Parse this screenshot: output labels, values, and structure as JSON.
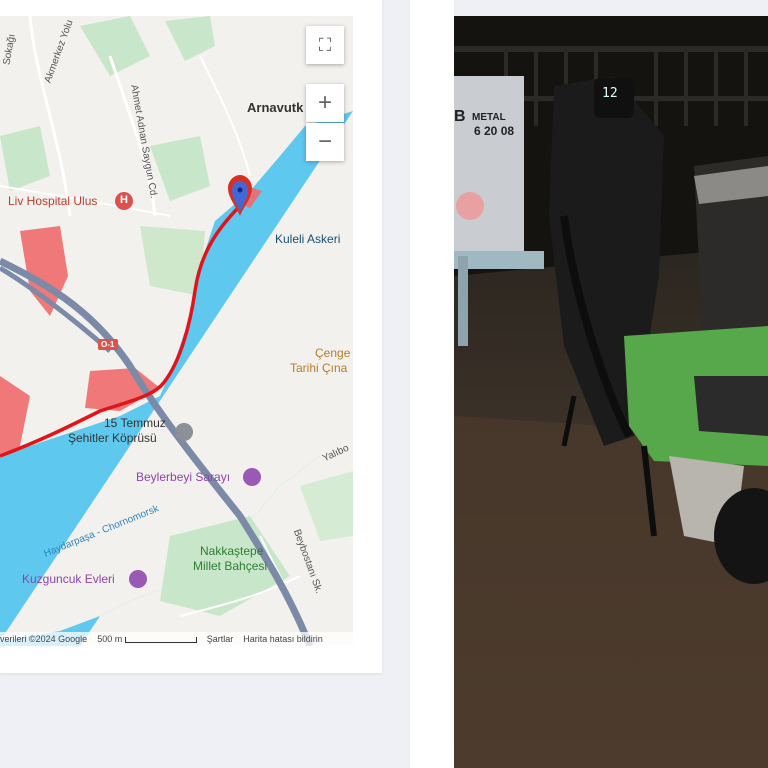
{
  "map": {
    "labels": {
      "akmerkez_yolu": "Akmerkez Yolu",
      "sokagi": "Sokağı",
      "ahmet_adnan": "Ahmet Adnan Saygun Cd.",
      "arnavutkoy": "Arnavutk",
      "liv_hospital": "Liv Hospital Ulus",
      "kuleli": "Kuleli Askeri",
      "cengel_1": "Çenge",
      "cengel_2": "Tarihi Çına",
      "bridge_1": "15 Temmuz",
      "bridge_2": "Şehitler Köprüsü",
      "beylerbeyi": "Beylerbeyi Sarayı",
      "yalibo": "Yalıbo",
      "haydarpasa": "Haydarpaşa - Chornomorsk",
      "nakkastepe_1": "Nakkaştepe",
      "nakkastepe_2": "Millet Bahçesi",
      "kuzguncuk": "Kuzguncuk Evleri",
      "beybostani": "Beybostanı Sk.",
      "highway_shield": "O-1",
      "hospital_badge": "H"
    },
    "controls": {
      "fullscreen_icon": "⛶",
      "zoom_in": "+",
      "zoom_out": "−"
    },
    "attribution": {
      "data": "verileri ©2024 Google",
      "scale": "500 m",
      "terms": "Şartlar",
      "report": "Harita hatası bildirin"
    },
    "colors": {
      "water": "#5ec8ee",
      "land": "#f2f1ed",
      "park": "#c8e6c9",
      "route": "#e3131b",
      "highlight": "#f06a6a",
      "highway": "#7b8aa6",
      "poi_red": "#d9534f",
      "poi_purple": "#8e44ad"
    }
  },
  "photo": {
    "sign_brand": "METAL",
    "sign_phone": "6 20 08",
    "sign_digit": "B",
    "display_text": "12"
  }
}
